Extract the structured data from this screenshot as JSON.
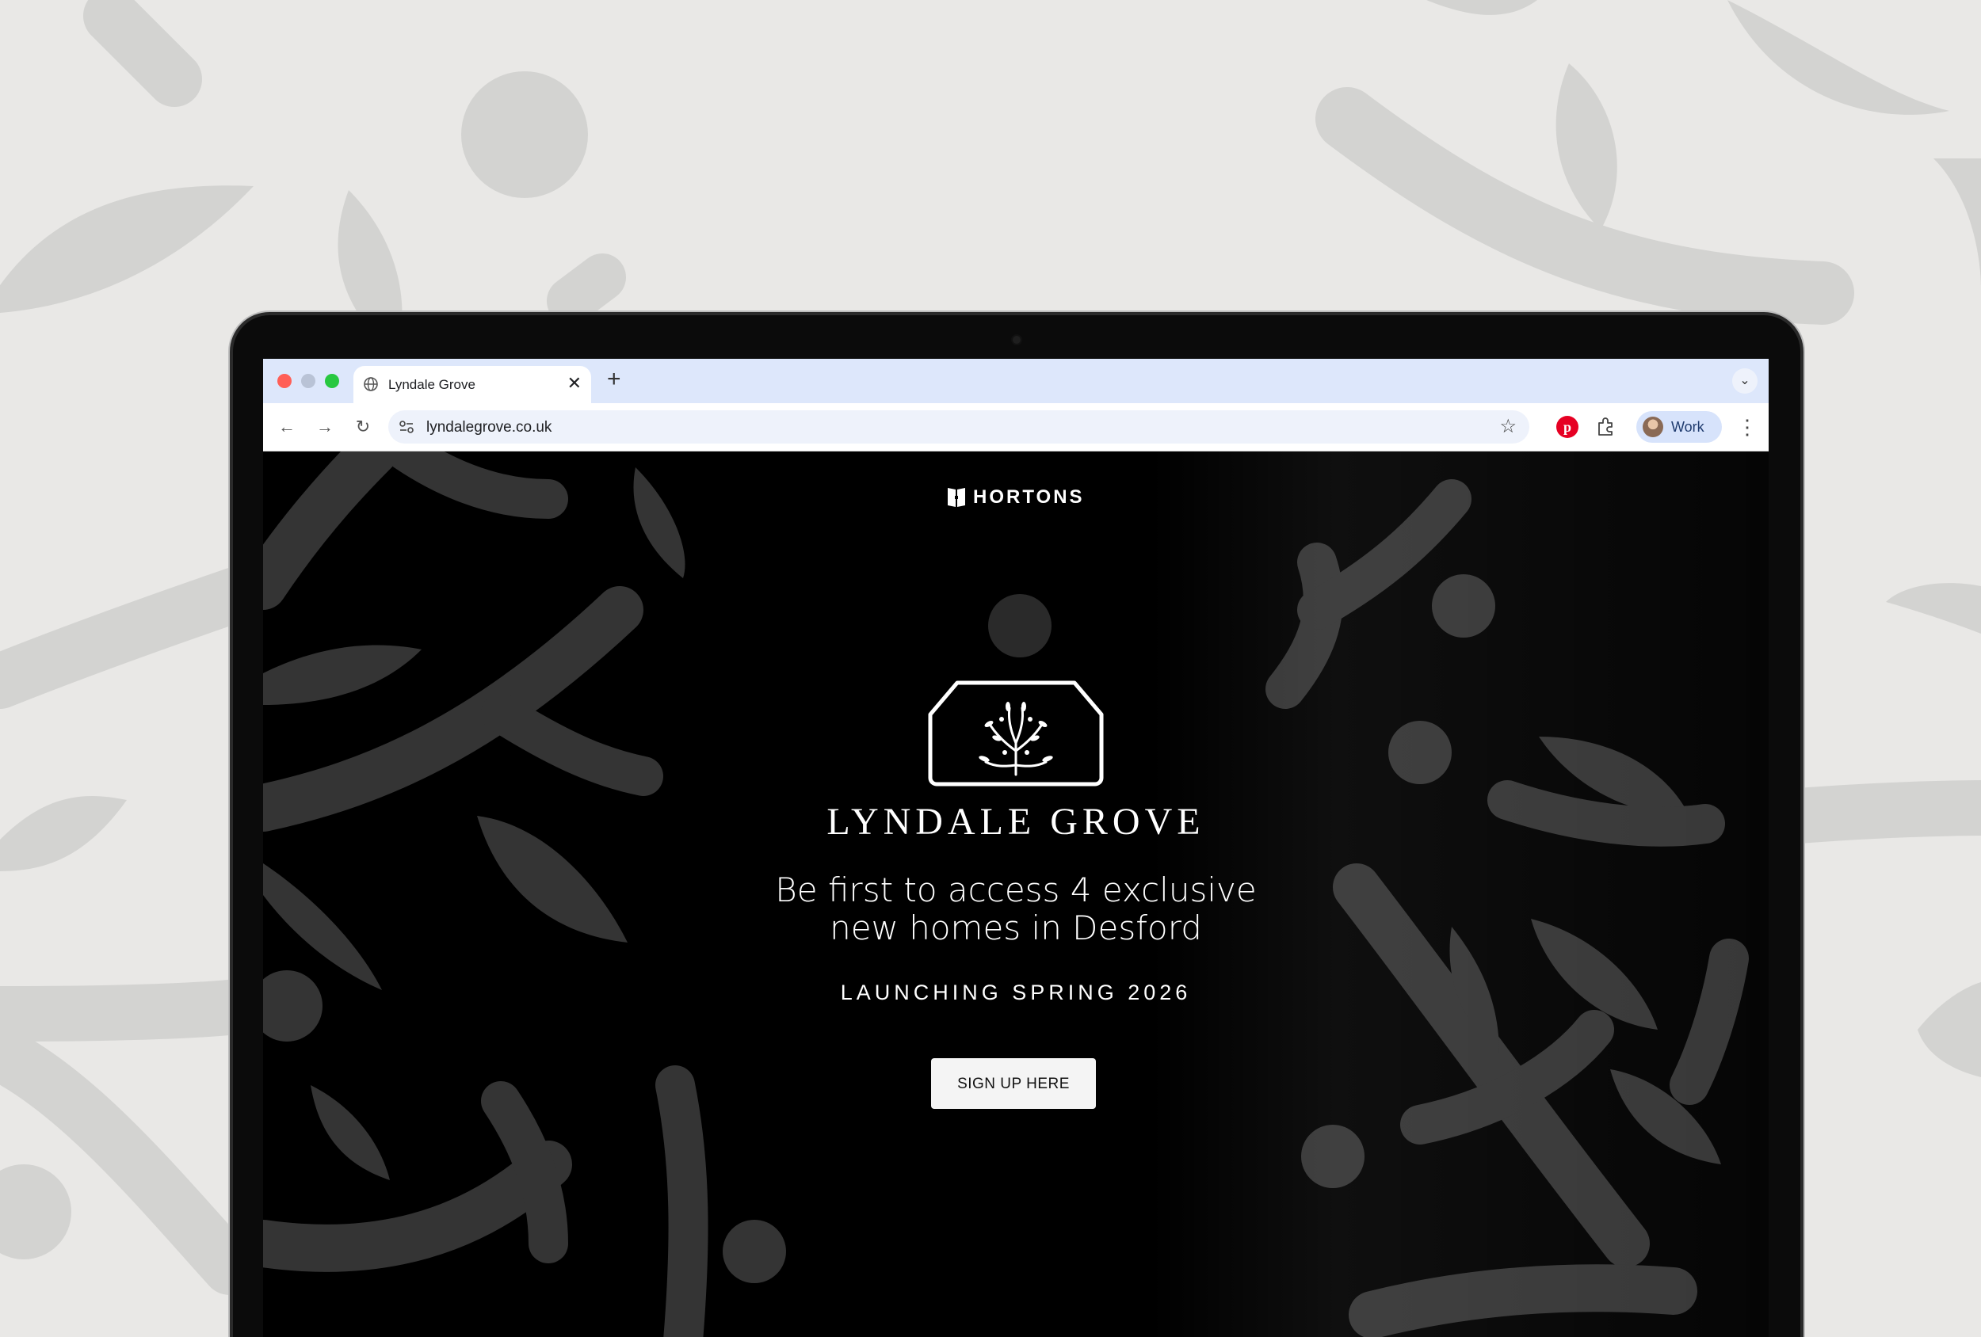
{
  "browser": {
    "tab_title": "Lyndale Grove",
    "new_tab_symbol": "+",
    "close_symbol": "✕",
    "url": "lyndalegrove.co.uk",
    "profile_name": "Work",
    "icons": [
      "globe-icon",
      "back-icon",
      "forward-icon",
      "reload-icon",
      "site-settings-icon",
      "star-icon",
      "pinterest-icon",
      "extensions-icon",
      "avatar",
      "more-icon",
      "tab-list-icon"
    ]
  },
  "page": {
    "brand": "HORTONS",
    "development_name": "LYNDALE GROVE",
    "headline_lines": [
      "Be first to access 4 exclusive",
      "new homes in Desford"
    ],
    "launch_text": "LAUNCHING SPRING 2026",
    "cta_label": "SIGN UP HERE"
  },
  "colors": {
    "background": "#e9e8e6",
    "pattern": "#d3d3d1",
    "site_background": "#000000",
    "site_pattern": "#3a3a3a",
    "tabbar": "#dde7fb",
    "cta_background": "#f4f4f4"
  }
}
